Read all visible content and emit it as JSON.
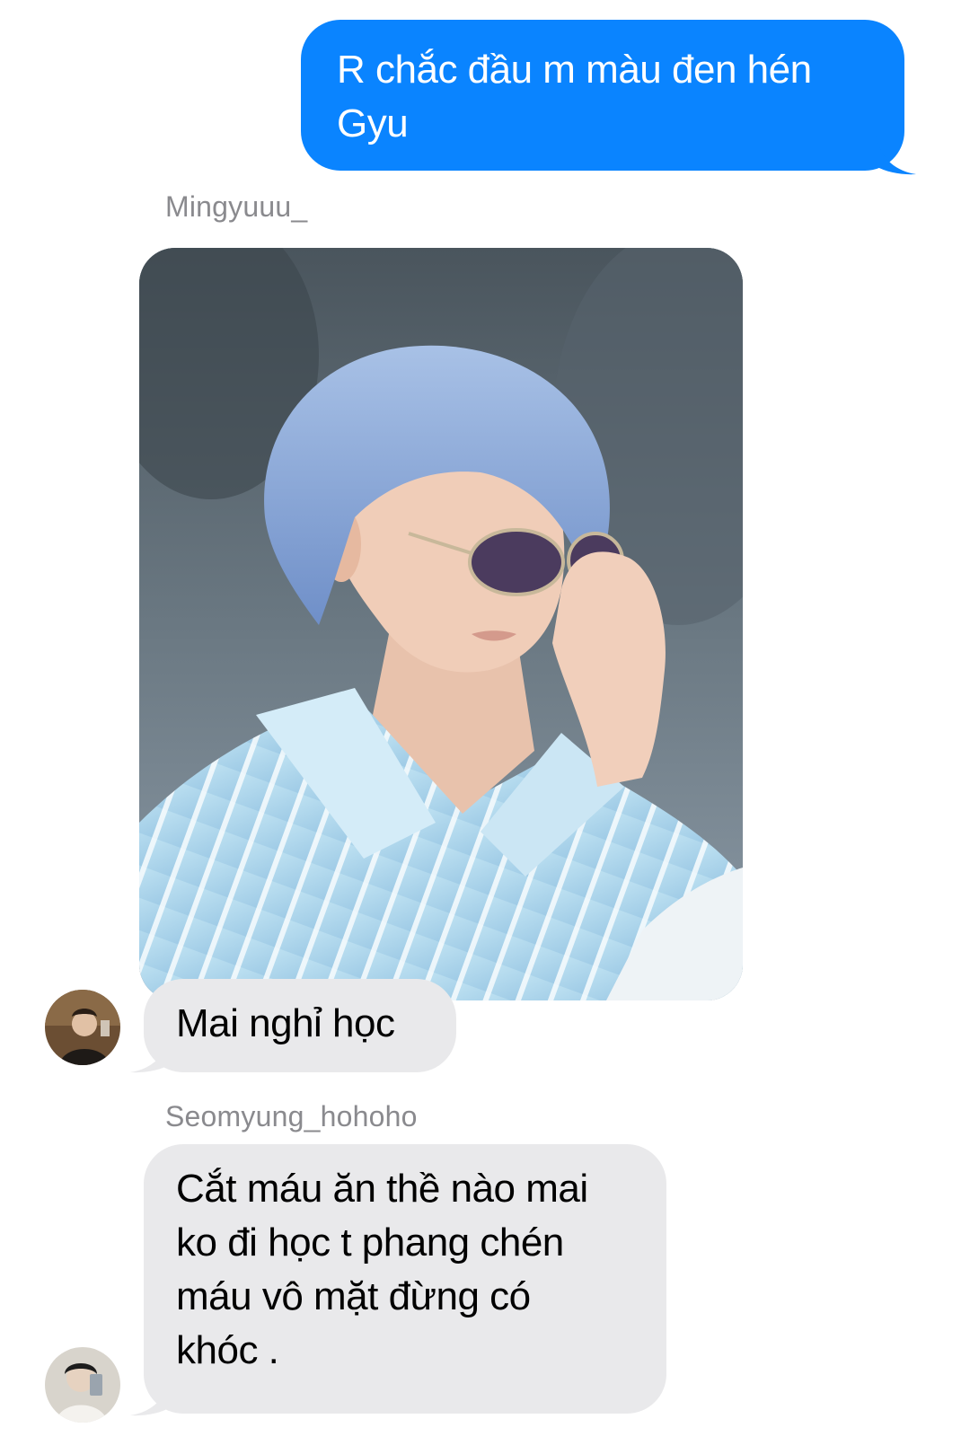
{
  "colors": {
    "outgoing_bubble": "#0a84ff",
    "incoming_bubble": "#e9e9eb",
    "sender_name": "#8a8a8e"
  },
  "messages": [
    {
      "direction": "outgoing",
      "lines": [
        "R chắc đầu m màu đen hén",
        "Gyu"
      ]
    },
    {
      "direction": "incoming",
      "sender": "Mingyuuu_",
      "attachment": "photo",
      "photo_icon": "person-with-blue-hair-and-sunglasses-photo"
    },
    {
      "direction": "incoming",
      "lines": [
        "Mai nghỉ học"
      ],
      "avatar_icon": "mingyuuu-avatar-icon"
    },
    {
      "direction": "incoming",
      "sender": "Seomyung_hohoho",
      "lines": [
        "Cắt máu ăn thề nào mai",
        "ko đi học t phang chén",
        "máu vô mặt đừng có",
        "khóc ."
      ],
      "avatar_icon": "seomyung-avatar-icon"
    }
  ]
}
